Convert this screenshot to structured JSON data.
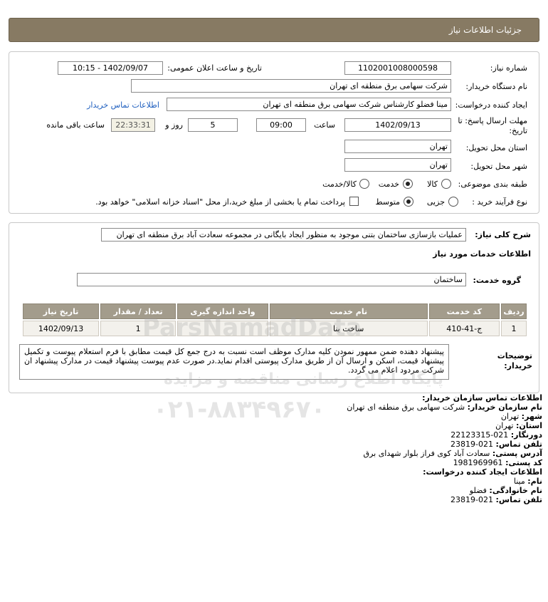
{
  "header": {
    "title": "جزئیات اطلاعات نیاز"
  },
  "form": {
    "need_number_label": "شماره نیاز:",
    "need_number": "1102001008000598",
    "announce_label": "تاریخ و ساعت اعلان عمومی:",
    "announce_value": "1402/09/07 - 10:15",
    "buyer_org_label": "نام دستگاه خریدار:",
    "buyer_org": "شرکت سهامی برق منطقه ای تهران",
    "creator_label": "ایجاد کننده درخواست:",
    "creator": "مینا فضلو کارشناس شرکت سهامی برق منطقه ای تهران",
    "contact_link": "اطلاعات تماس خریدار",
    "deadline_label": "مهلت ارسال پاسخ: تا",
    "deadline_label2": "تاریخ:",
    "deadline_date": "1402/09/13",
    "time_label": "ساعت",
    "deadline_time": "09:00",
    "days_value": "5",
    "days_label": "روز و",
    "remaining_time": "22:33:31",
    "remaining_label": "ساعت باقی مانده",
    "province_label": "استان محل تحویل:",
    "province": "تهران",
    "city_label": "شهر محل تحویل:",
    "city": "تهران",
    "category_label": "طبقه بندی موضوعی:",
    "category_options": [
      "کالا",
      "خدمت",
      "کالا/خدمت"
    ],
    "category_selected": "خدمت",
    "process_label": "نوع فرآیند خرید :",
    "process_options": [
      "جزیی",
      "متوسط"
    ],
    "process_selected": "متوسط",
    "payment_text": "پرداخت تمام یا بخشی از مبلغ خرید،از محل \"اسناد خزانه اسلامی\" خواهد بود."
  },
  "need": {
    "summary_label": "شرح کلی نیاز:",
    "summary": "عملیات بازسازی ساختمان بتنی موجود به منظور ایجاد بایگانی در مجموعه سعادت آباد برق منطقه ای تهران",
    "services_title": "اطلاعات خدمات مورد نیاز",
    "group_label": "گروه خدمت:",
    "group_value": "ساختمان"
  },
  "table": {
    "headers": [
      "ردیف",
      "کد خدمت",
      "نام خدمت",
      "واحد اندازه گیری",
      "تعداد / مقدار",
      "تاریخ نیاز"
    ],
    "rows": [
      [
        "1",
        "ج-41-410",
        "ساخت بنا",
        "",
        "1",
        "1402/09/13"
      ]
    ]
  },
  "notes": {
    "label1": "توضیحات",
    "label2": "خریدار:",
    "text": "پیشنهاد دهنده ضمن ممهور نمودن کلیه مدارک موظف است نسبت به درج جمع کل قیمت مطابق با فرم استعلام پیوست و تکمیل پیشنهاد قیمت، اسکن و ارسال آن از طریق مدارک پیوستی اقدام نماید.در صورت عدم پیوست پیشنهاد قیمت در مدارک پیشنهاد ان شرکت مردود اعلام می گردد."
  },
  "contact": {
    "title": "اطلاعات تماس سازمان خریدار:",
    "org_label": "نام سازمان خریدار:",
    "org": "شرکت سهامی برق منطقه ای تهران",
    "city_label": "شهر:",
    "city": "تهران",
    "province_label": "استان:",
    "province": "تهران",
    "fax_label": "دورنگار:",
    "fax": "021-22123315",
    "phone_label": "تلفن تماس:",
    "phone": "021-23819",
    "address_label": "آدرس پستی:",
    "address": "سعادت آباد کوی فراز بلوار شهدای برق",
    "postal_label": "کد پستی:",
    "postal": "1981969961",
    "creator_title": "اطلاعات ایجاد کننده درخواست:",
    "name_label": "نام:",
    "name": "مینا",
    "family_label": "نام خانوادگی:",
    "family": "فضلو",
    "creator_phone_label": "تلفن تماس:",
    "creator_phone": "021-23819"
  },
  "watermark": {
    "brand": "ParsNamadData",
    "line1": "پایگاه اطلاع رسانی مناقصه و مزایده",
    "phone": "۰۲۱-۸۸۳۴۹۶۷۰"
  }
}
